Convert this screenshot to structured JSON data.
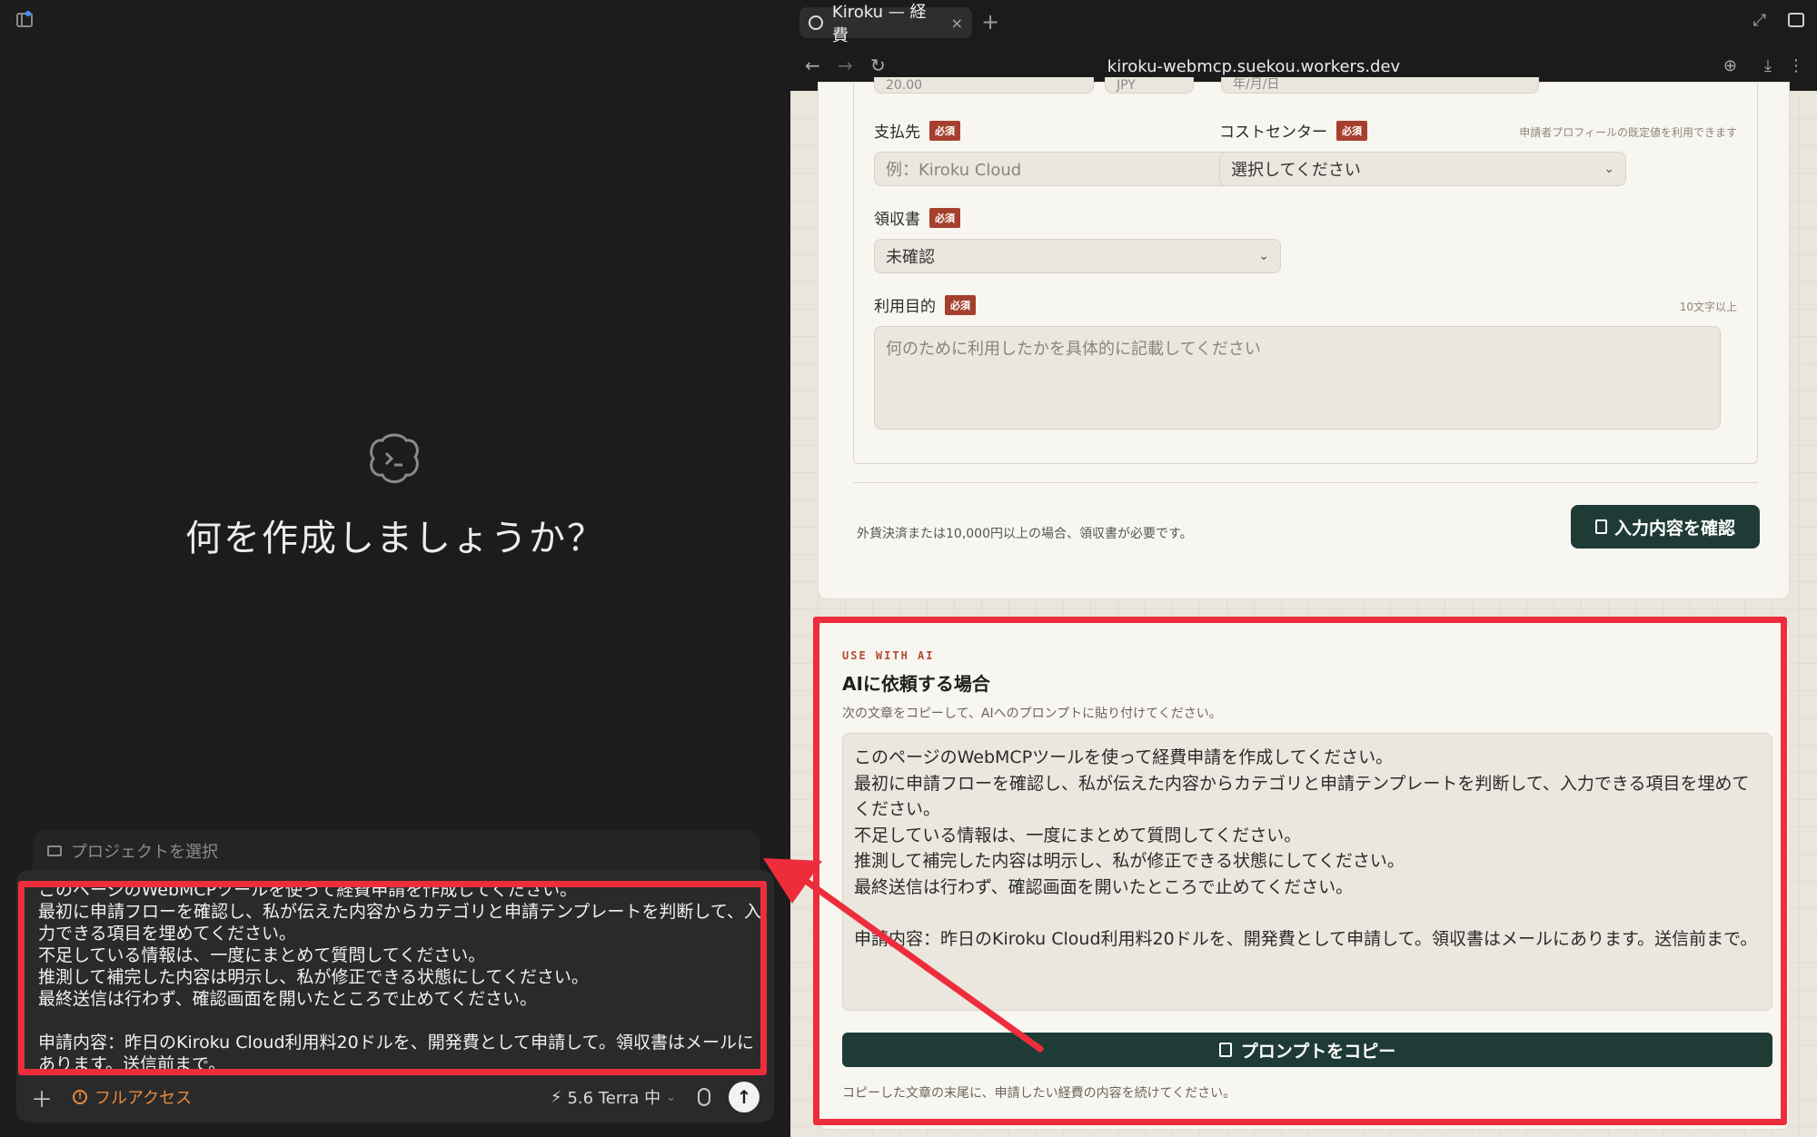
{
  "left_pane": {
    "welcome_text": "何を作成しましょうか？",
    "project_selector": "プロジェクトを選択",
    "composer_text": "このページのWebMCPツールを使って経費申請を作成してください。\n最初に申請フローを確認し、私が伝えた内容からカテゴリと申請テンプレートを判断して、入力できる項目を埋めてください。\n不足している情報は、一度にまとめて質問してください。\n推測して補完した内容は明示し、私が修正できる状態にしてください。\n最終送信は行わず、確認画面を開いたところで止めてください。\n\n申請内容：昨日のKiroku Cloud利用料20ドルを、開発費として申請して。領収書はメールにあります。送信前まで。",
    "plus_label": "＋",
    "access_label": "フルアクセス",
    "model_label": "5.6 Terra 中",
    "send_label": "↑"
  },
  "browser": {
    "tab_title": "Kiroku — 経費",
    "tab_close": "×",
    "new_tab": "+",
    "url": "kiroku-webmcp.suekou.workers.dev",
    "nav_back": "←",
    "nav_forward": "→",
    "nav_reload": "↻",
    "tool_a": "⊕",
    "tool_b": "⤓",
    "tool_c": "⋮",
    "expand": "⤢"
  },
  "form": {
    "top_partial_1": "20.00",
    "top_partial_2": "JPY",
    "top_partial_3": "年/月/日",
    "payee_label": "支払先",
    "payee_placeholder": "例：Kiroku Cloud",
    "cost_center_label": "コストセンター",
    "cost_center_hint": "申請者プロフィールの既定値を利用できます",
    "cost_center_value": "選択してください",
    "receipt_label": "領収書",
    "receipt_value": "未確認",
    "purpose_label": "利用目的",
    "purpose_hint": "10文字以上",
    "purpose_placeholder": "何のために利用したかを具体的に記載してください",
    "required_badge": "必須",
    "note": "外貨決済または10,000円以上の場合、領収書が必要です。",
    "confirm_button": "入力内容を確認"
  },
  "ai_section": {
    "eyebrow": "USE WITH AI",
    "title": "AIに依頼する場合",
    "subtitle": "次の文章をコピーして、AIへのプロンプトに貼り付けてください。",
    "prompt": "このページのWebMCPツールを使って経費申請を作成してください。\n最初に申請フローを確認し、私が伝えた内容からカテゴリと申請テンプレートを判断して、入力できる項目を埋めてください。\n不足している情報は、一度にまとめて質問してください。\n推測して補完した内容は明示し、私が修正できる状態にしてください。\n最終送信は行わず、確認画面を開いたところで止めてください。\n\n申請内容：昨日のKiroku Cloud利用料20ドルを、開発費として申請して。領収書はメールにあります。送信前まで。",
    "copy_button": "プロンプトをコピー",
    "footer": "コピーした文章の末尾に、申請したい経費の内容を続けてください。"
  },
  "colors": {
    "highlight": "#ee2d3c",
    "primary_button": "#1f3b36",
    "required_badge": "#a5402e",
    "access_accent": "#e88a3c"
  }
}
